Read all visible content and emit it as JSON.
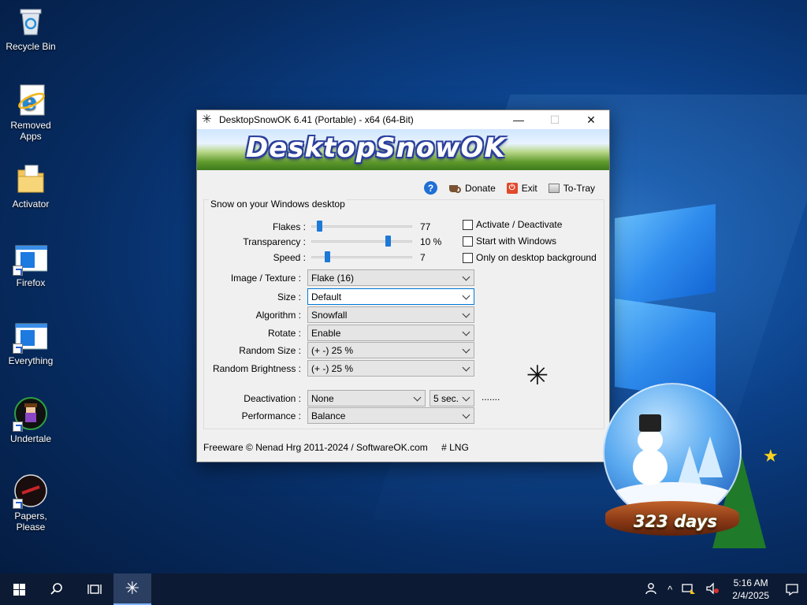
{
  "desktop": {
    "icons": [
      {
        "label": "Recycle Bin",
        "icon": "recycle-bin-icon"
      },
      {
        "label": "Removed Apps",
        "icon": "internet-explorer-icon"
      },
      {
        "label": "Activator",
        "icon": "folder-icon"
      },
      {
        "label": "Firefox",
        "icon": "app-window-icon"
      },
      {
        "label": "Everything",
        "icon": "app-window-icon"
      },
      {
        "label": "Undertale",
        "icon": "undertale-icon"
      },
      {
        "label": "Papers, Please",
        "icon": "papers-please-icon"
      }
    ]
  },
  "window": {
    "title": "DesktopSnowOK 6.41 (Portable) - x64 (64-Bit)",
    "minimize": "—",
    "maximize": "☐",
    "close": "✕",
    "banner": "DesktopSnowOK",
    "toolbar": {
      "help": "?",
      "donate": "Donate",
      "exit": "Exit",
      "totray": "To-Tray"
    },
    "group_title": "Snow on your Windows desktop",
    "sliders": [
      {
        "label": "Flakes :",
        "value": "77",
        "fraction": 0.06
      },
      {
        "label": "Transparency :",
        "value": "10 %",
        "fraction": 0.78
      },
      {
        "label": "Speed :",
        "value": "7",
        "fraction": 0.14
      }
    ],
    "checkboxes": [
      {
        "label": "Activate / Deactivate",
        "checked": false
      },
      {
        "label": "Start with Windows",
        "checked": false
      },
      {
        "label": "Only on desktop background",
        "checked": false
      }
    ],
    "selects": [
      {
        "label": "Image / Texture :",
        "value": "Flake (16)"
      },
      {
        "label": "Size :",
        "value": "Default"
      },
      {
        "label": "Algorithm :",
        "value": "Snowfall"
      },
      {
        "label": "Rotate :",
        "value": "Enable"
      },
      {
        "label": "Random Size :",
        "value": "(+ -) 25 %"
      },
      {
        "label": "Random Brightness :",
        "value": "(+ -) 25 %"
      }
    ],
    "deactivation": {
      "label": "Deactivation :",
      "value": "None",
      "time": "5 sec.",
      "extra": "......."
    },
    "performance": {
      "label": "Performance :",
      "value": "Balance"
    },
    "footer": {
      "copyright": "Freeware © Nenad Hrg 2011-2024 / SoftwareOK.com",
      "lng": "# LNG"
    }
  },
  "globe": {
    "days": "323 days"
  },
  "taskbar": {
    "time": "5:16 AM",
    "date": "2/4/2025"
  }
}
